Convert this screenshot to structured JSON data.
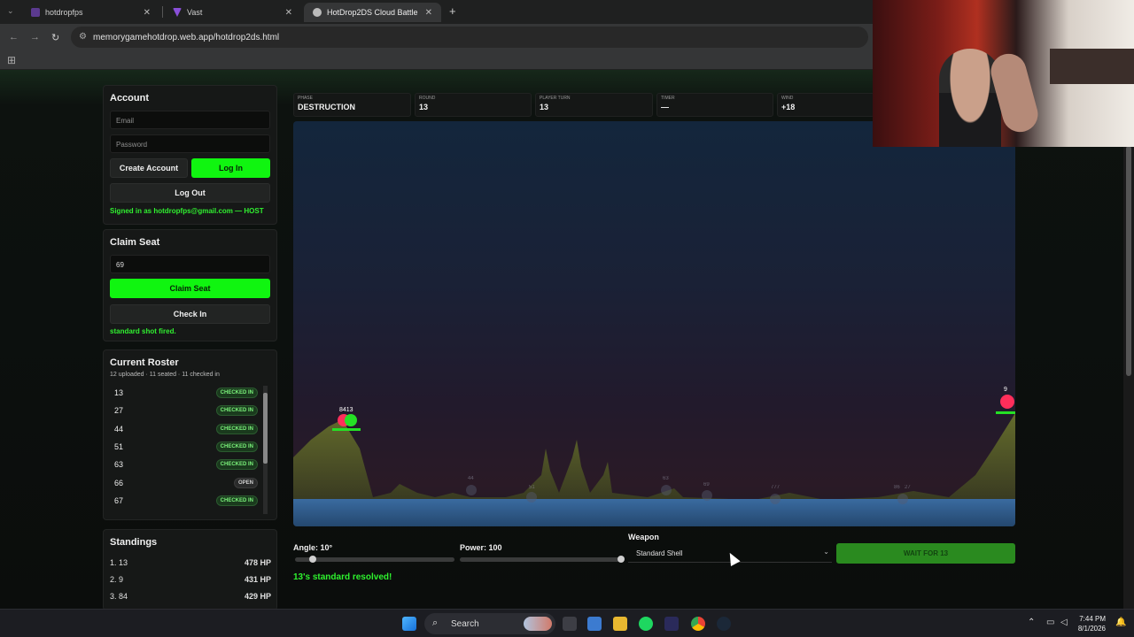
{
  "browser": {
    "tabs": [
      {
        "title": "hotdropfps",
        "active": false
      },
      {
        "title": "Vast",
        "active": false
      },
      {
        "title": "HotDrop2DS Cloud Battle",
        "active": true
      }
    ],
    "url": "memorygamehotdrop.web.app/hotdrop2ds.html"
  },
  "account": {
    "title": "Account",
    "email_placeholder": "Email",
    "password_placeholder": "Password",
    "create_label": "Create Account",
    "login_label": "Log In",
    "logout_label": "Log Out",
    "status": "Signed in as hotdropfps@gmail.com — HOST"
  },
  "seat": {
    "title": "Claim Seat",
    "seat_value": "69",
    "claim_label": "Claim Seat",
    "checkin_label": "Check In",
    "status": "standard shot fired."
  },
  "roster": {
    "title": "Current Roster",
    "summary": "12 uploaded · 11 seated · 11 checked in",
    "rows": [
      {
        "seat": "13",
        "status": "CHECKED IN"
      },
      {
        "seat": "27",
        "status": "CHECKED IN"
      },
      {
        "seat": "44",
        "status": "CHECKED IN"
      },
      {
        "seat": "51",
        "status": "CHECKED IN"
      },
      {
        "seat": "63",
        "status": "CHECKED IN"
      },
      {
        "seat": "66",
        "status": "OPEN"
      },
      {
        "seat": "67",
        "status": "CHECKED IN"
      }
    ]
  },
  "standings": {
    "title": "Standings",
    "rows": [
      {
        "rank": "1. 13",
        "hp": "478 HP"
      },
      {
        "rank": "2. 9",
        "hp": "431 HP"
      },
      {
        "rank": "3. 84",
        "hp": "429 HP"
      }
    ]
  },
  "stats": {
    "phase_label": "PHASE",
    "phase": "DESTRUCTION",
    "round_label": "ROUND",
    "round": "13",
    "turn_label": "PLAYER TURN",
    "turn": "13",
    "timer_label": "TIMER",
    "timer": "—",
    "wind_label": "WIND",
    "wind": "+18"
  },
  "game": {
    "left_tank_label": "8413",
    "right_tank_label": "9",
    "faded_labels": [
      "44",
      "51",
      "63",
      "69",
      "777",
      "86",
      "27"
    ]
  },
  "controls": {
    "angle_label": "Angle: 10°",
    "angle_value": 10,
    "power_label": "Power: 100",
    "power_value": 100,
    "weapon_label": "Weapon",
    "weapon_value": "Standard Shell",
    "fire_label": "WAIT FOR 13",
    "result": "13's standard resolved!"
  },
  "taskbar": {
    "search_label": "Search",
    "time": "7:44 PM",
    "date": "8/1/2026"
  },
  "colors": {
    "accent": "#10f510",
    "water": "#2f5a8c",
    "terrain": "#5a6b2a"
  }
}
